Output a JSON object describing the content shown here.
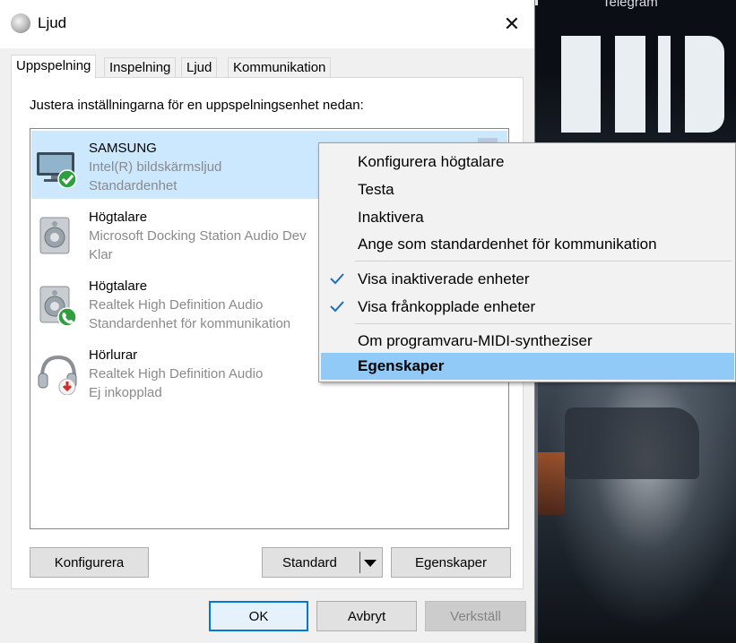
{
  "window": {
    "title": "Ljud",
    "close_glyph": "✕"
  },
  "desktop": {
    "caption": "Telegram"
  },
  "tabs": [
    {
      "label": "Uppspelning",
      "active": true
    },
    {
      "label": "Inspelning",
      "active": false
    },
    {
      "label": "Ljud",
      "active": false
    },
    {
      "label": "Kommunikation",
      "active": false
    }
  ],
  "playback": {
    "instruction": "Justera inställningarna för en uppspelningsenhet nedan:",
    "devices": [
      {
        "name": "SAMSUNG",
        "description": "Intel(R) bildskärmsljud",
        "status": "Standardenhet",
        "icon": "monitor-icon",
        "badge": "default-check-badge",
        "selected": true
      },
      {
        "name": "Högtalare",
        "description": "Microsoft Docking Station Audio Dev",
        "status": "Klar",
        "icon": "speaker-icon",
        "badge": "",
        "selected": false
      },
      {
        "name": "Högtalare",
        "description": "Realtek High Definition Audio",
        "status": "Standardenhet för kommunikation",
        "icon": "speaker-icon",
        "badge": "phone-badge",
        "selected": false
      },
      {
        "name": "Hörlurar",
        "description": "Realtek High Definition Audio",
        "status": "Ej inkopplad",
        "icon": "headphones-icon",
        "badge": "unplugged-badge",
        "selected": false
      }
    ]
  },
  "buttons": {
    "configure": "Konfigurera",
    "set_default": "Standard",
    "properties": "Egenskaper",
    "ok": "OK",
    "cancel": "Avbryt",
    "apply": "Verkställ"
  },
  "context_menu": {
    "items": [
      {
        "label": "Konfigurera högtalare",
        "checked": false,
        "highlighted": false
      },
      {
        "label": "Testa",
        "checked": false,
        "highlighted": false
      },
      {
        "label": "Inaktivera",
        "checked": false,
        "highlighted": false
      },
      {
        "label": "Ange som standardenhet för kommunikation",
        "checked": false,
        "highlighted": false
      },
      {
        "label": "Visa inaktiverade enheter",
        "checked": true,
        "highlighted": false
      },
      {
        "label": "Visa frånkopplade enheter",
        "checked": true,
        "highlighted": false
      },
      {
        "label": "Om programvaru-MIDI-syntheziser",
        "checked": false,
        "highlighted": false
      },
      {
        "label": "Egenskaper",
        "checked": false,
        "highlighted": true
      }
    ]
  },
  "colors": {
    "selection": "#cce8ff",
    "menu_highlight": "#91c9f7",
    "accent": "#0078d7",
    "check": "#1f6fbf"
  }
}
